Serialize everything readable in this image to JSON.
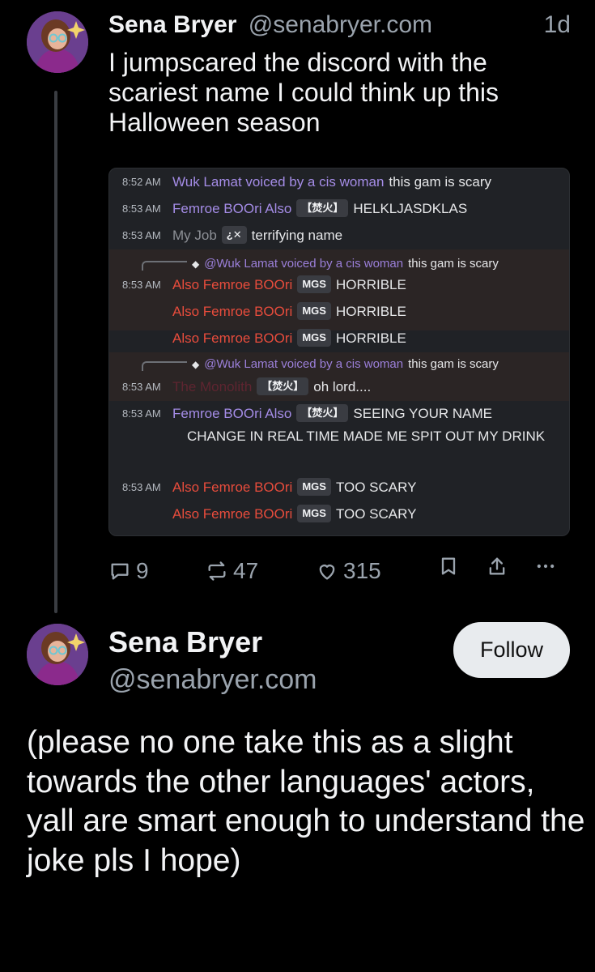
{
  "post1": {
    "author_name": "Sena Bryer",
    "handle": "@senabryer.com",
    "time": "1d",
    "text": "I jumpscared the discord with the scariest name I could think up this Halloween season",
    "embed": {
      "messages": [
        {
          "time": "8:52 AM",
          "user": "Wuk Lamat voiced by a cis woman",
          "text": "this gam is scary"
        },
        {
          "time": "8:53 AM",
          "user": "Femroe BOOri Also",
          "tag": "【焚火】",
          "text": "HELKLJASDKLAS"
        },
        {
          "time": "8:53 AM",
          "user": "My Job",
          "tag": "¿✕",
          "text": "terrifying name"
        },
        {
          "reply_to": "@Wuk Lamat voiced by a cis woman",
          "reply_text": "this gam is scary"
        },
        {
          "time": "8:53 AM",
          "user": "Also Femroe BOOri",
          "tag": "MGS",
          "text": "HORRIBLE"
        },
        {
          "user": "Also Femroe BOOri",
          "tag": "MGS",
          "text": "HORRIBLE"
        },
        {
          "user": "Also Femroe BOOri",
          "tag": "MGS",
          "text": "HORRIBLE"
        },
        {
          "reply_to": "@Wuk Lamat voiced by a cis woman",
          "reply_text": "this gam is scary"
        },
        {
          "time": "8:53 AM",
          "user": "The Monolith",
          "tag": "【焚火】",
          "text": "oh lord...."
        },
        {
          "time": "8:53 AM",
          "user": "Femroe BOOri Also",
          "tag": "【焚火】",
          "text": "SEEING YOUR NAME",
          "continued": "CHANGE IN REAL TIME MADE ME SPIT OUT MY DRINK"
        },
        {
          "time": "8:53 AM",
          "user": "Also Femroe BOOri",
          "tag": "MGS",
          "text": "TOO SCARY"
        },
        {
          "user": "Also Femroe BOOri",
          "tag": "MGS",
          "text": "TOO SCARY"
        }
      ]
    },
    "actions": {
      "replies": "9",
      "reposts": "47",
      "likes": "315"
    }
  },
  "post2": {
    "author_name": "Sena Bryer",
    "handle": "@senabryer.com",
    "follow_label": "Follow",
    "text": "(please no one take this as a slight towards the other languages' actors, yall are smart enough to understand the joke pls I hope)"
  },
  "colors": {
    "background": "#000000",
    "embed_bg": "#202226",
    "name_red": "#e74c3c",
    "name_purple": "#a48ce6",
    "muted": "#9aa3ad"
  },
  "icons": [
    "reply-icon",
    "repost-icon",
    "like-icon",
    "bookmark-icon",
    "share-icon",
    "more-icon"
  ]
}
